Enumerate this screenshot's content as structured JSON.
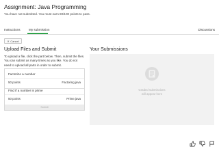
{
  "header": {
    "title": "Assignment: Java Programming",
    "subtitle": "You have not submitted. You must earn 80/100 points to pass."
  },
  "tabs": {
    "instructions": "Instructions",
    "my_submission": "My submission",
    "discussions": "Discussions"
  },
  "cancel_label": "Cancel",
  "upload": {
    "heading": "Upload Files and Submit",
    "instructions": "To upload a file, click the part below. Then, submit the files. You can submit as many times as you like. You do not need to upload all parts in order to submit.",
    "parts": [
      {
        "title": "Factorize a number",
        "points": "50 points",
        "file": "Factoring.java"
      },
      {
        "title": "Find if a number is prime",
        "points": "50 points",
        "file": "Prime.java"
      }
    ],
    "submit_label": "Submit"
  },
  "submissions": {
    "heading": "Your Submissions",
    "empty_line1": "Graded submissions",
    "empty_line2": "will appear here"
  },
  "footer": {
    "icons": [
      "thumbs-up-icon",
      "thumbs-down-icon",
      "flag-icon"
    ]
  },
  "colors": {
    "accent": "#2fa34a",
    "panel_bg": "#f2f2f2"
  }
}
